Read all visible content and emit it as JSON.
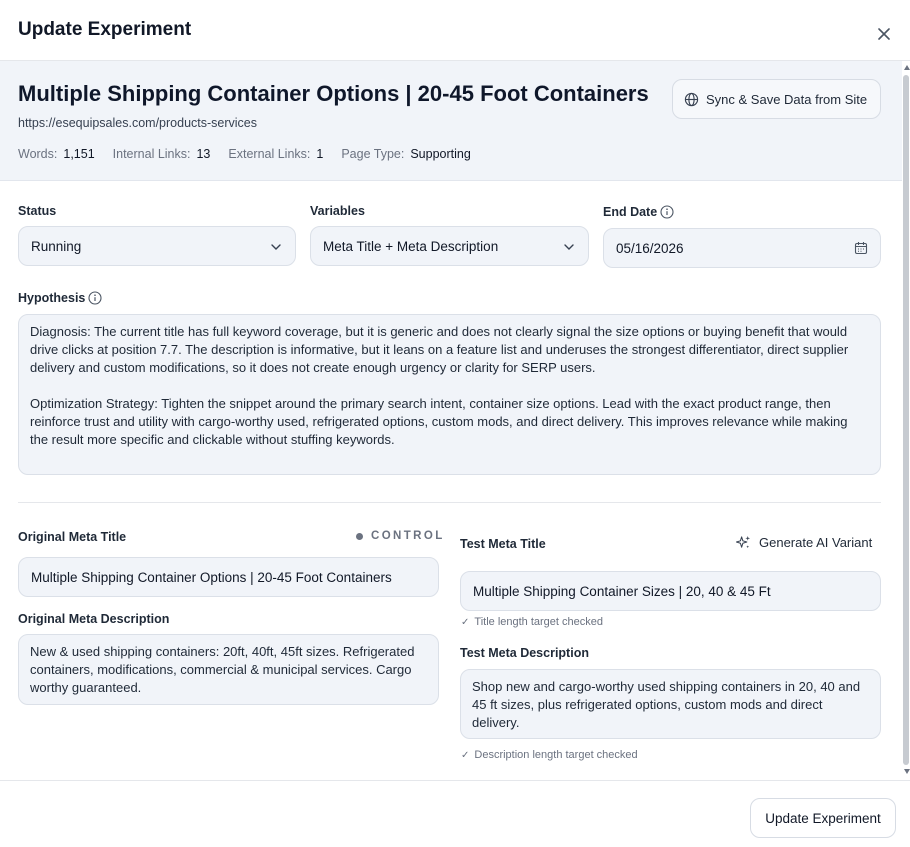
{
  "dialog": {
    "title": "Update Experiment",
    "close_icon": "close-icon"
  },
  "page_info": {
    "title": "Multiple Shipping Container Options | 20-45 Foot Containers",
    "url": "https://esequipsales.com/products-services",
    "stats": [
      {
        "label": "Words:",
        "value": "1,151"
      },
      {
        "label": "Internal Links:",
        "value": "13"
      },
      {
        "label": "External Links:",
        "value": "1"
      },
      {
        "label": "Page Type:",
        "value": "Supporting"
      }
    ],
    "sync_button": {
      "label": "Sync & Save Data from Site",
      "icon": "globe-icon"
    }
  },
  "form": {
    "status": {
      "label": "Status",
      "value": "Running"
    },
    "variables": {
      "label": "Variables",
      "value": "Meta Title + Meta Description"
    },
    "end_date": {
      "label": "End Date",
      "value": "05/16/2026"
    },
    "hypothesis": {
      "label": "Hypothesis",
      "value": "Diagnosis: The current title has full keyword coverage, but it is generic and does not clearly signal the size options or buying benefit that would drive clicks at position 7.7. The description is informative, but it leans on a feature list and underuses the strongest differentiator, direct supplier delivery and custom modifications, so it does not create enough urgency or clarity for SERP users.\n\nOptimization Strategy: Tighten the snippet around the primary search intent, container size options. Lead with the exact product range, then reinforce trust and utility with cargo-worthy used, refrigerated options, custom mods, and direct delivery. This improves relevance while making the result more specific and clickable without stuffing keywords."
    }
  },
  "original": {
    "control_badge": "CONTROL",
    "meta_title_label": "Original Meta Title",
    "meta_title": "Multiple Shipping Container Options | 20-45 Foot Containers",
    "meta_description_label": "Original Meta Description",
    "meta_description": "New & used shipping containers: 20ft, 40ft, 45ft sizes. Refrigerated containers, modifications, commercial & municipal services. Cargo worthy guaranteed."
  },
  "test": {
    "meta_title_label": "Test Meta Title",
    "generate_button": "Generate AI Variant",
    "meta_title": "Multiple Shipping Container Sizes | 20, 40 & 45 Ft",
    "title_check": "Title length target checked",
    "meta_description_label": "Test Meta Description",
    "meta_description": "Shop new and cargo-worthy used shipping containers in 20, 40 and 45 ft sizes, plus refrigerated options, custom mods and direct delivery.",
    "description_check": "Description length target checked"
  },
  "footer": {
    "update_button": "Update Experiment"
  }
}
